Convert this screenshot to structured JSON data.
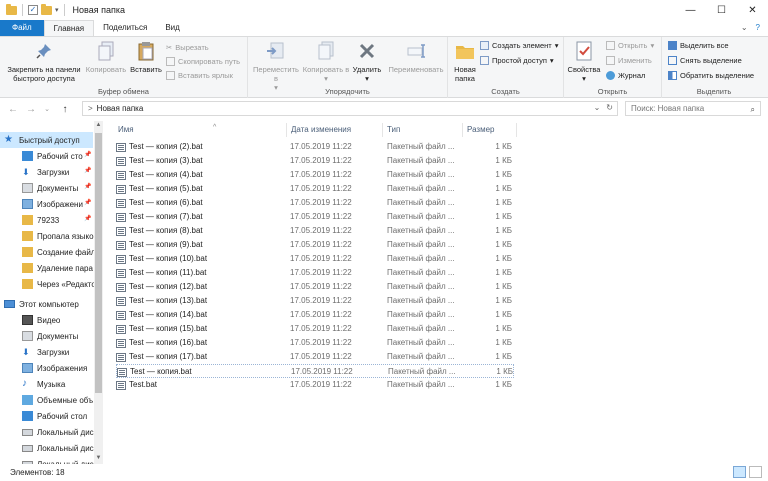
{
  "window": {
    "title": "Новая папка",
    "min": "—",
    "max": "☐",
    "close": "✕"
  },
  "tabs": {
    "file": "Файл",
    "home": "Главная",
    "share": "Поделиться",
    "view": "Вид",
    "collapse": "⌄",
    "help": "?"
  },
  "ribbon": {
    "clipboard": {
      "title": "Буфер обмена",
      "pin": "Закрепить на панели быстрого доступа",
      "copy": "Копировать",
      "paste": "Вставить",
      "cut": "Вырезать",
      "copy_path": "Скопировать путь",
      "paste_shortcut": "Вставить ярлык"
    },
    "organize": {
      "title": "Упорядочить",
      "move_to": "Переместить в",
      "copy_to": "Копировать в",
      "delete": "Удалить",
      "rename": "Переименовать"
    },
    "create": {
      "title": "Создать",
      "new_folder": "Новая папка",
      "new_item": "Создать элемент",
      "easy_access": "Простой доступ"
    },
    "open": {
      "title": "Открыть",
      "properties": "Свойства",
      "open": "Открыть",
      "edit": "Изменить",
      "history": "Журнал"
    },
    "select": {
      "title": "Выделить",
      "select_all": "Выделить все",
      "select_none": "Снять выделение",
      "invert": "Обратить выделение"
    }
  },
  "address": {
    "back": "←",
    "forward": "→",
    "recent": "⌄",
    "up": "↑",
    "separator": ">",
    "path": "Новая папка",
    "dropdown": "⌄",
    "refresh": "↻",
    "search_placeholder": "Поиск: Новая папка",
    "search_icon": "⌕"
  },
  "nav": {
    "quick_access": "Быстрый доступ",
    "pinned": [
      {
        "label": "Рабочий сто",
        "pin": true
      },
      {
        "label": "Загрузки",
        "pin": true
      },
      {
        "label": "Документы",
        "pin": true
      },
      {
        "label": "Изображени",
        "pin": true
      },
      {
        "label": "79233",
        "pin": true
      },
      {
        "label": "Пропала языко",
        "pin": false
      },
      {
        "label": "Создание файл",
        "pin": false
      },
      {
        "label": "Удаление пара",
        "pin": false
      },
      {
        "label": "Через «Редактор",
        "pin": false
      }
    ],
    "this_pc": "Этот компьютер",
    "pc_items": [
      "Видео",
      "Документы",
      "Загрузки",
      "Изображения",
      "Музыка",
      "Объемные объ",
      "Рабочий стол",
      "Локальный дис",
      "Локальный дис",
      "Локальный дис"
    ],
    "pin_glyph": "📌",
    "scroll_up": "▲",
    "scroll_down": "▼"
  },
  "columns": {
    "name": "Имя",
    "date": "Дата изменения",
    "type": "Тип",
    "size": "Размер",
    "sort_arrow": "^"
  },
  "files": [
    {
      "name": "Test — копия (2).bat",
      "date": "17.05.2019 11:22",
      "type": "Пакетный файл ...",
      "size": "1 КБ"
    },
    {
      "name": "Test — копия (3).bat",
      "date": "17.05.2019 11:22",
      "type": "Пакетный файл ...",
      "size": "1 КБ"
    },
    {
      "name": "Test — копия (4).bat",
      "date": "17.05.2019 11:22",
      "type": "Пакетный файл ...",
      "size": "1 КБ"
    },
    {
      "name": "Test — копия (5).bat",
      "date": "17.05.2019 11:22",
      "type": "Пакетный файл ...",
      "size": "1 КБ"
    },
    {
      "name": "Test — копия (6).bat",
      "date": "17.05.2019 11:22",
      "type": "Пакетный файл ...",
      "size": "1 КБ"
    },
    {
      "name": "Test — копия (7).bat",
      "date": "17.05.2019 11:22",
      "type": "Пакетный файл ...",
      "size": "1 КБ"
    },
    {
      "name": "Test — копия (8).bat",
      "date": "17.05.2019 11:22",
      "type": "Пакетный файл ...",
      "size": "1 КБ"
    },
    {
      "name": "Test — копия (9).bat",
      "date": "17.05.2019 11:22",
      "type": "Пакетный файл ...",
      "size": "1 КБ"
    },
    {
      "name": "Test — копия (10).bat",
      "date": "17.05.2019 11:22",
      "type": "Пакетный файл ...",
      "size": "1 КБ"
    },
    {
      "name": "Test — копия (11).bat",
      "date": "17.05.2019 11:22",
      "type": "Пакетный файл ...",
      "size": "1 КБ"
    },
    {
      "name": "Test — копия (12).bat",
      "date": "17.05.2019 11:22",
      "type": "Пакетный файл ...",
      "size": "1 КБ"
    },
    {
      "name": "Test — копия (13).bat",
      "date": "17.05.2019 11:22",
      "type": "Пакетный файл ...",
      "size": "1 КБ"
    },
    {
      "name": "Test — копия (14).bat",
      "date": "17.05.2019 11:22",
      "type": "Пакетный файл ...",
      "size": "1 КБ"
    },
    {
      "name": "Test — копия (15).bat",
      "date": "17.05.2019 11:22",
      "type": "Пакетный файл ...",
      "size": "1 КБ"
    },
    {
      "name": "Test — копия (16).bat",
      "date": "17.05.2019 11:22",
      "type": "Пакетный файл ...",
      "size": "1 КБ"
    },
    {
      "name": "Test — копия (17).bat",
      "date": "17.05.2019 11:22",
      "type": "Пакетный файл ...",
      "size": "1 КБ"
    },
    {
      "name": "Test — копия.bat",
      "date": "17.05.2019 11:22",
      "type": "Пакетный файл ...",
      "size": "1 КБ",
      "focused": true
    },
    {
      "name": "Test.bat",
      "date": "17.05.2019 11:22",
      "type": "Пакетный файл ...",
      "size": "1 КБ"
    }
  ],
  "status": {
    "count": "Элементов: 18"
  },
  "colors": {
    "accent": "#1979ca",
    "selection": "#cce8ff",
    "folder": "#e8b847"
  }
}
